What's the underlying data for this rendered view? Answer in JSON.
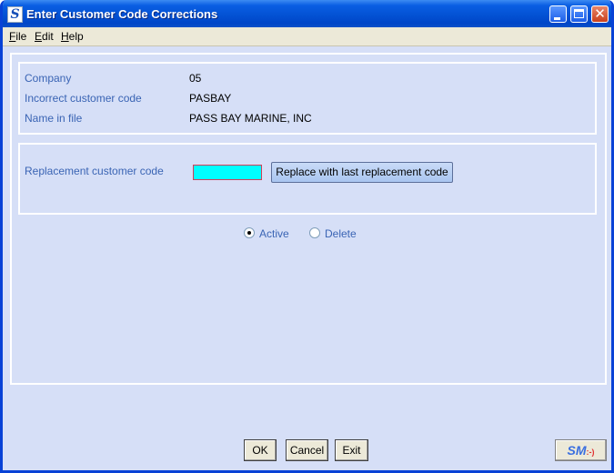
{
  "window": {
    "title": "Enter Customer Code Corrections",
    "app_icon_letter": "S"
  },
  "menu": {
    "file": {
      "mnemonic": "F",
      "rest": "ile"
    },
    "edit": {
      "mnemonic": "E",
      "rest": "dit"
    },
    "help": {
      "mnemonic": "H",
      "rest": "elp"
    }
  },
  "info": {
    "company_label": "Company",
    "company_value": "05",
    "incorrect_label": "Incorrect customer code",
    "incorrect_value": "PASBAY",
    "name_label": "Name in file",
    "name_value": "PASS BAY MARINE, INC"
  },
  "replacement": {
    "label": "Replacement customer code",
    "value": "",
    "button_label": "Replace with last replacement code"
  },
  "status": {
    "active_label": "Active",
    "delete_label": "Delete",
    "selected": "Active"
  },
  "buttons": {
    "ok": "OK",
    "cancel": "Cancel",
    "exit": "Exit"
  },
  "logo": {
    "text": "SM",
    "smile": ":-)"
  },
  "colors": {
    "title_bar": "#0352d4",
    "background": "#d6dff7",
    "label_text": "#3a64b4",
    "input_fill": "#00ffff"
  }
}
